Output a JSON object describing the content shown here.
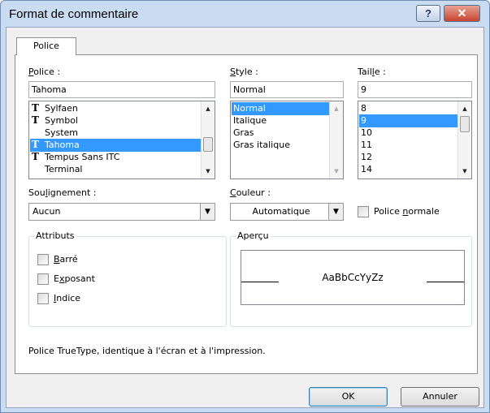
{
  "window": {
    "title": "Format de commentaire",
    "help_glyph": "?",
    "close_glyph": "✕"
  },
  "tabs": [
    {
      "label": "Police",
      "selected": true
    }
  ],
  "font": {
    "label": "Police :",
    "underline_char": "P",
    "label_rest": "olice :",
    "value": "Tahoma",
    "items": [
      {
        "label": "Sylfaen",
        "icon": "truetype-icon",
        "selected": false
      },
      {
        "label": "Symbol",
        "icon": "truetype-icon",
        "selected": false
      },
      {
        "label": "System",
        "icon": "",
        "selected": false
      },
      {
        "label": "Tahoma",
        "icon": "truetype-icon",
        "selected": true
      },
      {
        "label": "Tempus Sans ITC",
        "icon": "truetype-icon",
        "selected": false
      },
      {
        "label": "Terminal",
        "icon": "",
        "selected": false
      }
    ]
  },
  "style": {
    "underline_char": "S",
    "label_rest": "tyle :",
    "value": "Normal",
    "items": [
      {
        "label": "Normal",
        "selected": true
      },
      {
        "label": "Italique",
        "selected": false
      },
      {
        "label": "Gras",
        "selected": false
      },
      {
        "label": "Gras italique",
        "selected": false
      }
    ]
  },
  "size": {
    "label_pre": "Tail",
    "underline_char": "l",
    "label_post": "e :",
    "value": "9",
    "items": [
      {
        "label": "8",
        "selected": false
      },
      {
        "label": "9",
        "selected": true
      },
      {
        "label": "10",
        "selected": false
      },
      {
        "label": "11",
        "selected": false
      },
      {
        "label": "12",
        "selected": false
      },
      {
        "label": "14",
        "selected": false
      }
    ]
  },
  "underline": {
    "label_pre": "Sou",
    "underline_char": "l",
    "label_post": "ignement :",
    "value": "Aucun"
  },
  "color": {
    "underline_char": "C",
    "label_rest": "ouleur :",
    "value": "Automatique"
  },
  "normal_font": {
    "label_pre": "Police ",
    "underline_char": "n",
    "label_post": "ormale",
    "checked": false
  },
  "attributes": {
    "title": "Attributs",
    "items": [
      {
        "underline_char": "B",
        "rest": "arré",
        "checked": false
      },
      {
        "pre": "E",
        "underline_char": "x",
        "rest": "posant",
        "checked": false
      },
      {
        "underline_char": "I",
        "rest": "ndice",
        "checked": false
      }
    ]
  },
  "preview": {
    "title": "Aperçu",
    "sample": "AaBbCcYyZz"
  },
  "description": "Police TrueType, identique à l'écran et à l'impression.",
  "buttons": {
    "ok": "OK",
    "cancel": "Annuler"
  }
}
